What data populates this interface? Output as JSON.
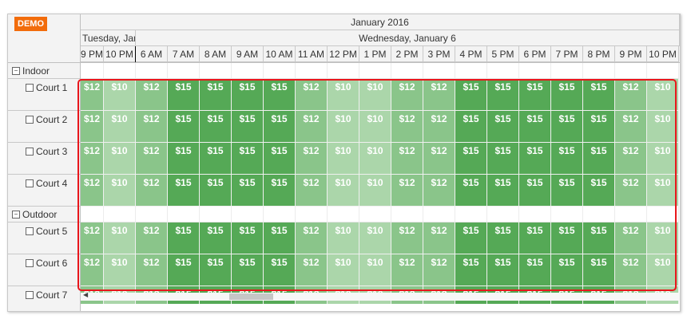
{
  "badge": "DEMO",
  "timeline": {
    "month": "January 2016",
    "days": [
      {
        "label": "Tuesday, Jan"
      },
      {
        "label": "Wednesday, January 6"
      }
    ],
    "hours": [
      "9 PM",
      "10 PM",
      "6 AM",
      "7 AM",
      "8 AM",
      "9 AM",
      "10 AM",
      "11 AM",
      "12 PM",
      "1 PM",
      "2 PM",
      "3 PM",
      "4 PM",
      "5 PM",
      "6 PM",
      "7 PM",
      "8 PM",
      "9 PM",
      "10 PM"
    ]
  },
  "groups": [
    {
      "name": "Indoor",
      "toggle": "−",
      "courts": [
        "Court 1",
        "Court 2",
        "Court 3",
        "Court 4"
      ]
    },
    {
      "name": "Outdoor",
      "toggle": "−",
      "courts": [
        "Court 5",
        "Court 6",
        "Court 7"
      ]
    }
  ],
  "prices": [
    "$12",
    "$10",
    "$12",
    "$15",
    "$15",
    "$15",
    "$15",
    "$12",
    "$10",
    "$10",
    "$12",
    "$12",
    "$15",
    "$15",
    "$15",
    "$15",
    "$15",
    "$12",
    "$10"
  ],
  "price_colors": {
    "$15": "#55a956",
    "$12": "#8ac58a",
    "$10": "#abd6aa"
  }
}
